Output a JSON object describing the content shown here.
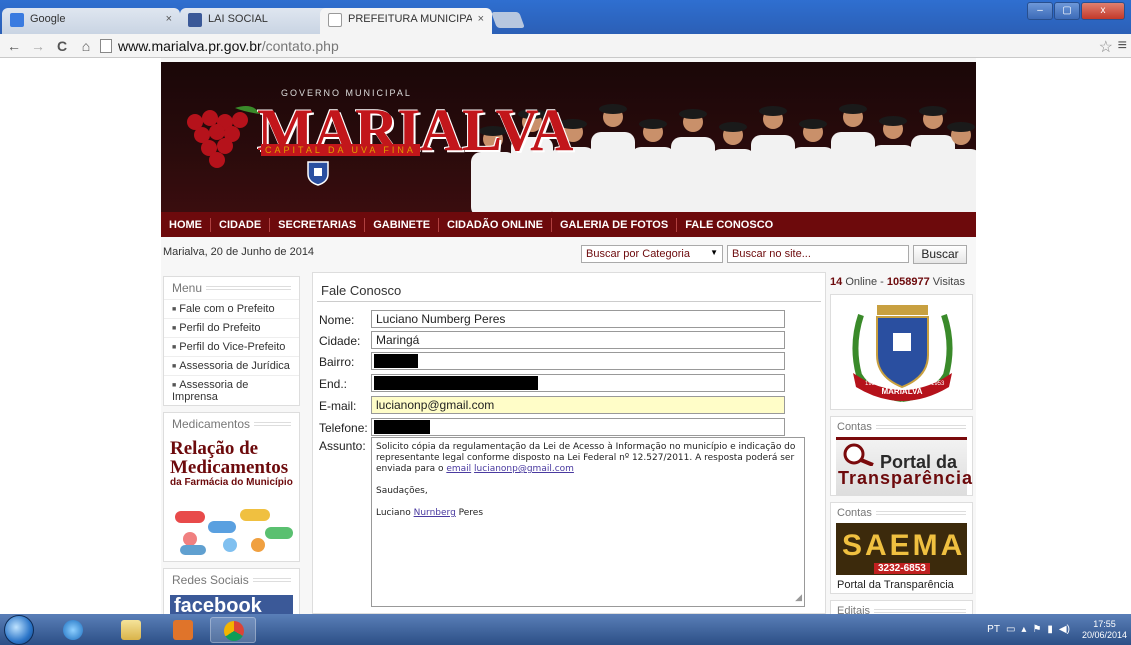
{
  "browser": {
    "tabs": [
      {
        "label": "Google",
        "favicon_color": "#3a7be0",
        "active": false
      },
      {
        "label": "LAI SOCIAL",
        "favicon_color": "#3b5998",
        "active": false
      },
      {
        "label": "PREFEITURA MUNICIPAL |",
        "favicon_color": "#ffffff",
        "active": true
      }
    ],
    "tab_close_glyph": "×",
    "url_host": "www.marialva.pr.gov.br",
    "url_path": "/contato.php",
    "back_glyph": "←",
    "forward_glyph": "→",
    "reload_glyph": "C",
    "home_glyph": "⌂",
    "star_glyph": "☆",
    "menu_glyph": "≡",
    "window_buttons": {
      "minimize": "–",
      "maximize": "▢",
      "close": "x"
    }
  },
  "site": {
    "logo": {
      "top_text": "GOVERNO MUNICIPAL",
      "name": "MARIALVA",
      "subtitle": "CAPITAL DA UVA FINA"
    },
    "nav": [
      "HOME",
      "CIDADE",
      "SECRETARIAS",
      "GABINETE",
      "CIDADÃO ONLINE",
      "GALERIA DE FOTOS",
      "FALE CONOSCO"
    ],
    "date_text": "Marialva, 20 de Junho de 2014",
    "category_select": "Buscar por Categoria",
    "search_placeholder": "Buscar no site...",
    "search_button": "Buscar",
    "left_menu": {
      "title": "Menu",
      "items": [
        "Fale com o Prefeito",
        "Perfil do Prefeito",
        "Perfil do Vice-Prefeito",
        "Assessoria de Jurídica",
        "Assessoria de Imprensa"
      ]
    },
    "medicamentos": {
      "title": "Medicamentos",
      "line1": "Relação de",
      "line2": "Medicamentos",
      "line3": "da Farmácia do Município"
    },
    "redes_sociais": {
      "title": "Redes Sociais",
      "facebook_text": "facebook"
    },
    "form": {
      "title": "Fale Conosco",
      "fields": [
        {
          "label": "Nome:",
          "value": "Luciano Numberg Peres"
        },
        {
          "label": "Cidade:",
          "value": "Maringá"
        },
        {
          "label": "Bairro:",
          "value": ""
        },
        {
          "label": "End.:",
          "value": ""
        },
        {
          "label": "E-mail:",
          "value": "lucianonp@gmail.com"
        },
        {
          "label": "Telefone:",
          "value": ""
        }
      ],
      "assunto_label": "Assunto:",
      "assunto_p1": "Solicito cópia da regulamentação da Lei de Acesso à Informação no município e indicação do representante legal conforme disposto na Lei Federal nº 12.527/2011. A resposta poderá ser enviada para o ",
      "assunto_email_word": "email",
      "assunto_email": "lucianonp@gmail.com",
      "assunto_p2": "Saudações,",
      "assunto_p3_first": "Luciano ",
      "assunto_p3_mid": "Nurnberg",
      "assunto_p3_last": " Peres"
    },
    "right": {
      "online_count": "14",
      "online_label": "Online - ",
      "visits": "1058977",
      "visits_label": "Visitas",
      "crest_text": "MARIALVA",
      "crest_year_left": "1951",
      "crest_year_right": "1953",
      "contas1_title": "Contas",
      "portal_line1": "Portal da",
      "portal_line2": "Transparência",
      "contas2_title": "Contas",
      "saema_text": "SAEMA",
      "saema_phone": "3232-6853",
      "portal_caption": "Portal da Transparência",
      "editais_title": "Editais"
    }
  },
  "taskbar": {
    "language": "PT",
    "time": "17:55",
    "date": "20/06/2014"
  }
}
